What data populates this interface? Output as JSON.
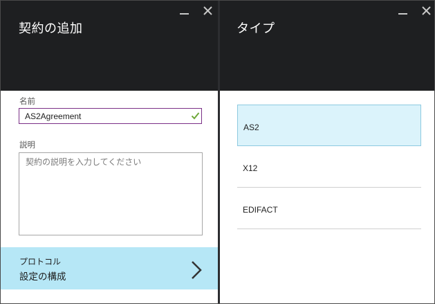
{
  "left_blade": {
    "title": "契約の追加",
    "name_label": "名前",
    "name_value": "AS2Agreement",
    "desc_label": "説明",
    "desc_placeholder": "契約の説明を入力してください",
    "protocol_label": "プロトコル",
    "protocol_value": "設定の構成"
  },
  "right_blade": {
    "title": "タイプ",
    "types": [
      {
        "label": "AS2",
        "selected": true
      },
      {
        "label": "X12",
        "selected": false
      },
      {
        "label": "EDIFACT",
        "selected": false
      }
    ]
  },
  "colors": {
    "header": "#1e1f21",
    "selected_row": "#b6e7f6",
    "selected_type": "#dbf3fb",
    "input_border_active": "#7a2f86",
    "valid_check": "#6fa83a"
  }
}
